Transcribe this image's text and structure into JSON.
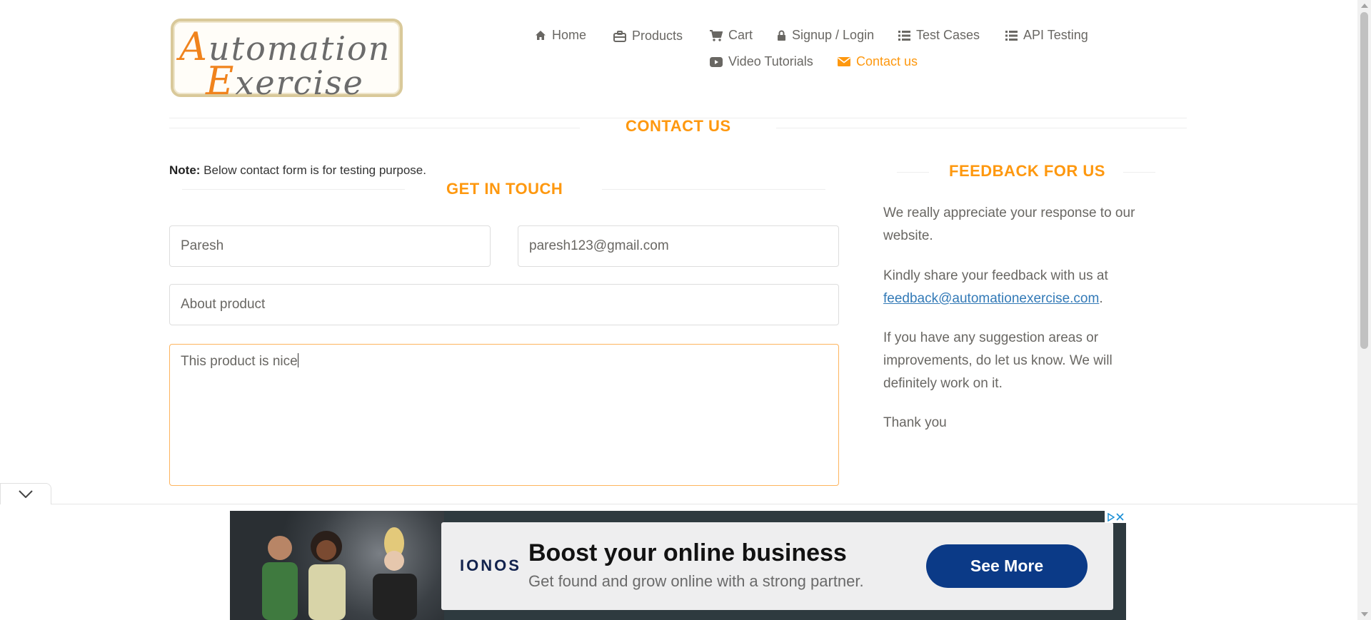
{
  "logo": {
    "line1_cap": "A",
    "line1_rest": "utomation",
    "line2_cap": "E",
    "line2_rest": "xercise"
  },
  "nav": {
    "home": "Home",
    "products": "Products",
    "cart": "Cart",
    "login": "Signup / Login",
    "test_cases": "Test Cases",
    "api_testing": "API Testing",
    "video_tutorials": "Video Tutorials",
    "contact_us": "Contact us",
    "active": "contact_us",
    "accent_color": "#fe980f"
  },
  "page_title": "CONTACT US",
  "note": {
    "label": "Note:",
    "text": " Below contact form is for testing purpose."
  },
  "get_in_touch": "GET IN TOUCH",
  "form": {
    "name": "Paresh",
    "email": "paresh123@gmail.com",
    "subject": "About product",
    "message": "This product is nice"
  },
  "feedback": {
    "title": "FEEDBACK FOR US",
    "p1": "We really appreciate your response to our website.",
    "p2_text": "Kindly share your feedback with us at ",
    "p2_email": "feedback@automationexercise.com",
    "p2_end": ".",
    "p3": "If you have any suggestion areas or improvements, do let us know. We will definitely work on it.",
    "p4": "Thank you"
  },
  "ad": {
    "brand": "IONOS",
    "title": "Boost your online business",
    "subtitle": "Get found and grow online with a strong partner.",
    "button": "See More",
    "button_color": "#0b3a87"
  }
}
